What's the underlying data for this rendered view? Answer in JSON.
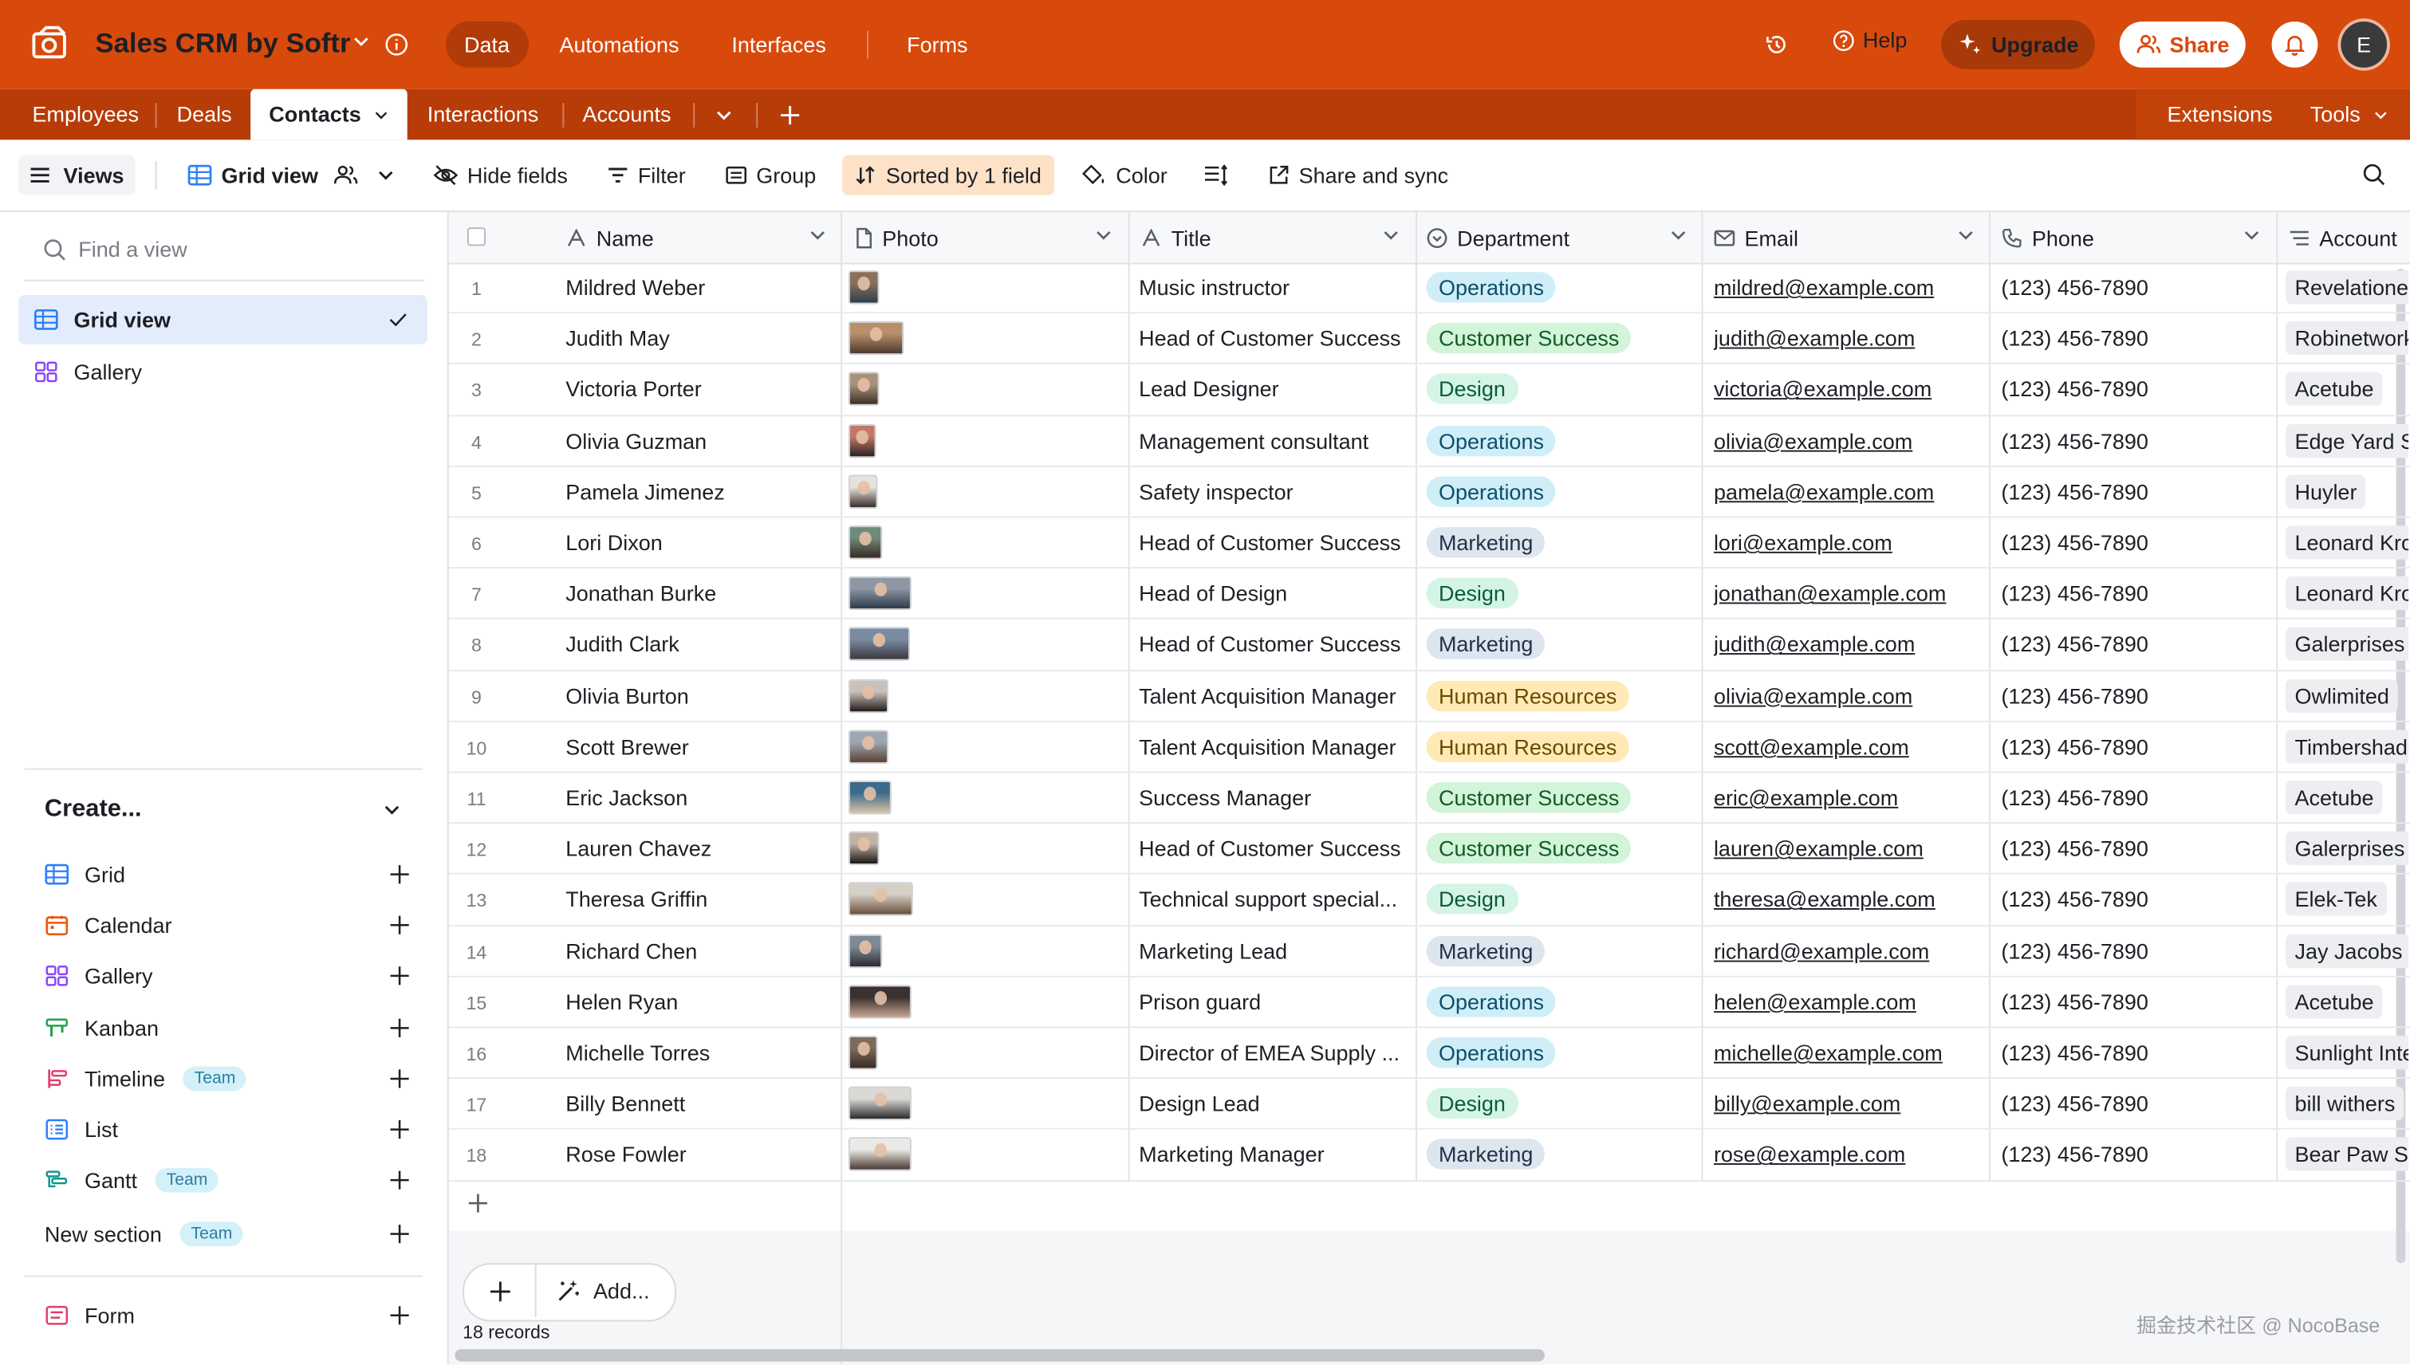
{
  "app": {
    "title": "Sales CRM by Softr",
    "colors": {
      "brand": "#d8490c",
      "brand_dark": "#b83c08"
    },
    "top_tabs": [
      {
        "label": "Data",
        "active": true
      },
      {
        "label": "Automations"
      },
      {
        "label": "Interfaces"
      },
      {
        "label": "Forms"
      }
    ],
    "help_label": "Help",
    "upgrade_label": "Upgrade",
    "share_label": "Share",
    "avatar_initial": "E"
  },
  "tables": {
    "tabs": [
      "Employees",
      "Deals",
      "Contacts",
      "Interactions",
      "Accounts"
    ],
    "active": "Contacts",
    "extensions_label": "Extensions",
    "tools_label": "Tools"
  },
  "viewbar": {
    "views_label": "Views",
    "view_name": "Grid view",
    "hide_fields": "Hide fields",
    "filter": "Filter",
    "group": "Group",
    "sorted": "Sorted by 1 field",
    "color": "Color",
    "share_sync": "Share and sync"
  },
  "sidebar": {
    "find_placeholder": "Find a view",
    "views": [
      {
        "label": "Grid view",
        "icon": "grid-icon",
        "active": true
      },
      {
        "label": "Gallery",
        "icon": "gallery-icon"
      }
    ],
    "create_title": "Create...",
    "create_items": [
      {
        "label": "Grid",
        "icon": "grid-icon",
        "color": "#2d7ff9"
      },
      {
        "label": "Calendar",
        "icon": "calendar-icon",
        "color": "#e8590c"
      },
      {
        "label": "Gallery",
        "icon": "gallery-icon",
        "color": "#8b46ff"
      },
      {
        "label": "Kanban",
        "icon": "kanban-icon",
        "color": "#20a34a"
      },
      {
        "label": "Timeline",
        "icon": "timeline-icon",
        "color": "#e33d6a",
        "badge": "Team"
      },
      {
        "label": "List",
        "icon": "list-icon",
        "color": "#2d7ff9"
      },
      {
        "label": "Gantt",
        "icon": "gantt-icon",
        "color": "#11978f",
        "badge": "Team"
      },
      {
        "label": "New section",
        "icon": "",
        "badge": "Team"
      },
      {
        "label": "Form",
        "icon": "form-icon",
        "color": "#e33d6a"
      }
    ]
  },
  "grid": {
    "columns": [
      "Name",
      "Photo",
      "Title",
      "Department",
      "Email",
      "Phone",
      "Account"
    ],
    "department_colors": {
      "Operations": {
        "bg": "#cfeef8",
        "fg": "#0d4f6a"
      },
      "Customer Success": {
        "bg": "#d2f4d8",
        "fg": "#125a24"
      },
      "Design": {
        "bg": "#d4f5e6",
        "fg": "#0c5a3a"
      },
      "Marketing": {
        "bg": "#dde5ee",
        "fg": "#223247"
      },
      "Human Resources": {
        "bg": "#ffeab6",
        "fg": "#6a4a00"
      }
    },
    "rows": [
      {
        "num": "1",
        "name": "Mildred Weber",
        "title": "Music instructor",
        "department": "Operations",
        "email": "mildred@example.com",
        "phone": "(123) 456-7890",
        "account": "Revelationet"
      },
      {
        "num": "2",
        "name": "Judith May",
        "title": "Head of Customer Success",
        "department": "Customer Success",
        "email": "judith@example.com",
        "phone": "(123) 456-7890",
        "account": "Robinetworks"
      },
      {
        "num": "3",
        "name": "Victoria Porter",
        "title": "Lead Designer",
        "department": "Design",
        "email": "victoria@example.com",
        "phone": "(123) 456-7890",
        "account": "Acetube"
      },
      {
        "num": "4",
        "name": "Olivia Guzman",
        "title": "Management consultant",
        "department": "Operations",
        "email": "olivia@example.com",
        "phone": "(123) 456-7890",
        "account": "Edge Yard Se"
      },
      {
        "num": "5",
        "name": "Pamela Jimenez",
        "title": "Safety inspector",
        "department": "Operations",
        "email": "pamela@example.com",
        "phone": "(123) 456-7890",
        "account": "Huyler"
      },
      {
        "num": "6",
        "name": "Lori Dixon",
        "title": "Head of Customer Success",
        "department": "Marketing",
        "email": "lori@example.com",
        "phone": "(123) 456-7890",
        "account": "Leonard Kro"
      },
      {
        "num": "7",
        "name": "Jonathan Burke",
        "title": "Head of Design",
        "department": "Design",
        "email": "jonathan@example.com",
        "phone": "(123) 456-7890",
        "account": "Leonard Kro"
      },
      {
        "num": "8",
        "name": "Judith Clark",
        "title": "Head of Customer Success",
        "department": "Marketing",
        "email": "judith@example.com",
        "phone": "(123) 456-7890",
        "account": "Galerprises"
      },
      {
        "num": "9",
        "name": "Olivia Burton",
        "title": "Talent Acquisition Manager",
        "department": "Human Resources",
        "email": "olivia@example.com",
        "phone": "(123) 456-7890",
        "account": "Owlimited"
      },
      {
        "num": "10",
        "name": "Scott Brewer",
        "title": "Talent Acquisition Manager",
        "department": "Human Resources",
        "email": "scott@example.com",
        "phone": "(123) 456-7890",
        "account": "Timbershade"
      },
      {
        "num": "11",
        "name": "Eric Jackson",
        "title": "Success Manager",
        "department": "Customer Success",
        "email": "eric@example.com",
        "phone": "(123) 456-7890",
        "account": "Acetube"
      },
      {
        "num": "12",
        "name": "Lauren Chavez",
        "title": "Head of Customer Success",
        "department": "Customer Success",
        "email": "lauren@example.com",
        "phone": "(123) 456-7890",
        "account": "Galerprises"
      },
      {
        "num": "13",
        "name": "Theresa Griffin",
        "title": "Technical support special...",
        "department": "Design",
        "email": "theresa@example.com",
        "phone": "(123) 456-7890",
        "account": "Elek-Tek"
      },
      {
        "num": "14",
        "name": "Richard Chen",
        "title": "Marketing Lead",
        "department": "Marketing",
        "email": "richard@example.com",
        "phone": "(123) 456-7890",
        "account": "Jay Jacobs"
      },
      {
        "num": "15",
        "name": "Helen Ryan",
        "title": "Prison guard",
        "department": "Operations",
        "email": "helen@example.com",
        "phone": "(123) 456-7890",
        "account": "Acetube"
      },
      {
        "num": "16",
        "name": "Michelle Torres",
        "title": "Director of EMEA Supply ...",
        "department": "Operations",
        "email": "michelle@example.com",
        "phone": "(123) 456-7890",
        "account": "Sunlight Inte"
      },
      {
        "num": "17",
        "name": "Billy Bennett",
        "title": "Design Lead",
        "department": "Design",
        "email": "billy@example.com",
        "phone": "(123) 456-7890",
        "account": "bill withers"
      },
      {
        "num": "18",
        "name": "Rose Fowler",
        "title": "Marketing Manager",
        "department": "Marketing",
        "email": "rose@example.com",
        "phone": "(123) 456-7890",
        "account": "Bear Paw So"
      }
    ],
    "add_label": "Add...",
    "records_label": "18 records"
  },
  "watermark": "掘金技术社区 @ NocoBase"
}
